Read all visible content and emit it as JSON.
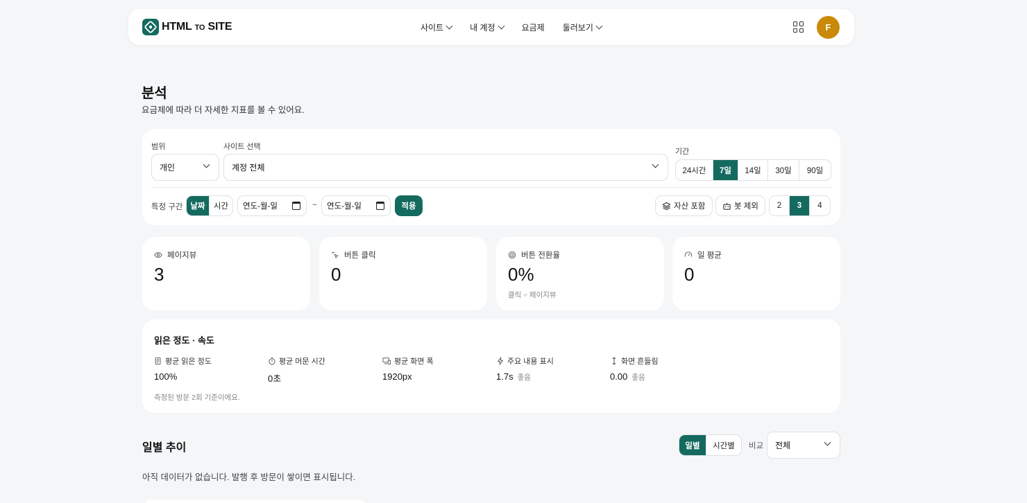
{
  "brand": {
    "name_main": "HTML",
    "name_small": "TO",
    "name_tail": "SITE",
    "color": "#146a5e"
  },
  "nav": {
    "items": [
      "사이트",
      "내 계정",
      "요금제",
      "둘러보기"
    ]
  },
  "avatar": {
    "initial": "F",
    "color": "#c98a0a"
  },
  "page": {
    "title": "분석",
    "subtitle": "요금제에 따라 더 자세한 지표를 볼 수 있어요."
  },
  "filters": {
    "scope_label": "범위",
    "scope_value": "개인",
    "site_label": "사이트 선택",
    "site_value": "계정 전체",
    "period_label": "기간",
    "periods": [
      "24시간",
      "7일",
      "14일",
      "30일",
      "90일"
    ],
    "period_active": "7일",
    "range_label": "특정 구간",
    "range_modes": [
      "날짜",
      "시간"
    ],
    "date_from": "연도-월-일",
    "tilde": "~",
    "date_to": "연도-월-일",
    "apply": "적용",
    "include_assets": "자산 포함",
    "exclude_bots": "봇 제외",
    "levels": [
      "2",
      "3",
      "4"
    ],
    "level_active": "3"
  },
  "stats": [
    {
      "label": "페이지뷰",
      "value": "3",
      "note": ""
    },
    {
      "label": "버튼 클릭",
      "value": "0",
      "note": ""
    },
    {
      "label": "버튼 전환율",
      "value": "0%",
      "note": "클릭 ÷ 페이지뷰"
    },
    {
      "label": "일 평균",
      "value": "0",
      "note": ""
    }
  ],
  "reading": {
    "title": "읽은 정도 · 속도",
    "metrics": [
      {
        "label": "평균 읽은 정도",
        "value": "100%",
        "tag": ""
      },
      {
        "label": "평균 머문 시간",
        "value": "0초",
        "tag": ""
      },
      {
        "label": "평균 화면 폭",
        "value": "1920px",
        "tag": ""
      },
      {
        "label": "주요 내용 표시",
        "value": "1.7s",
        "tag": "좋음"
      },
      {
        "label": "화면 흔들림",
        "value": "0.00",
        "tag": "좋음"
      }
    ],
    "note": "측정된 방문 2회 기준이에요."
  },
  "daily": {
    "title": "일별 추이",
    "modes": [
      "일별",
      "시간별"
    ],
    "compare_label": "비교",
    "compare_value": "전체",
    "empty": "아직 데이터가 없습니다. 발행 후 방문이 쌓이면 표시됩니다."
  }
}
